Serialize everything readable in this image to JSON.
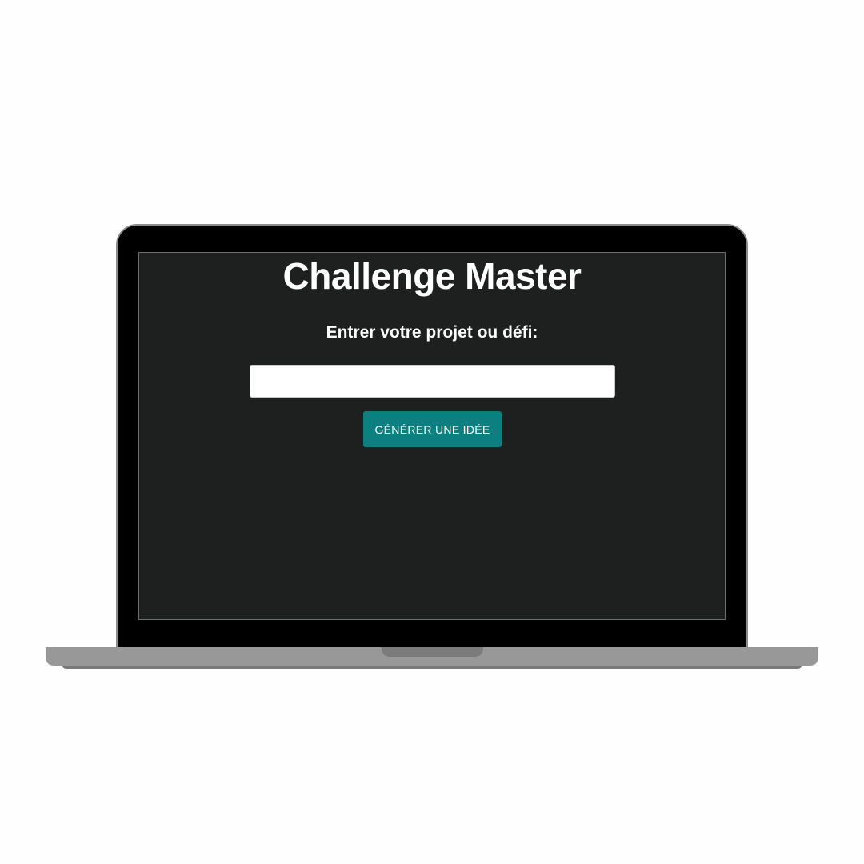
{
  "app": {
    "title": "Challenge Master",
    "prompt_label": "Entrer votre projet ou défi:",
    "input": {
      "value": "",
      "placeholder": ""
    },
    "generate_button_label": "GÉNÉRER UNE IDÉE"
  },
  "colors": {
    "screen_background": "#1e2020",
    "accent_button": "#0c8080",
    "text": "#ffffff",
    "bezel": "#000000",
    "laptop_body": "#989898"
  }
}
